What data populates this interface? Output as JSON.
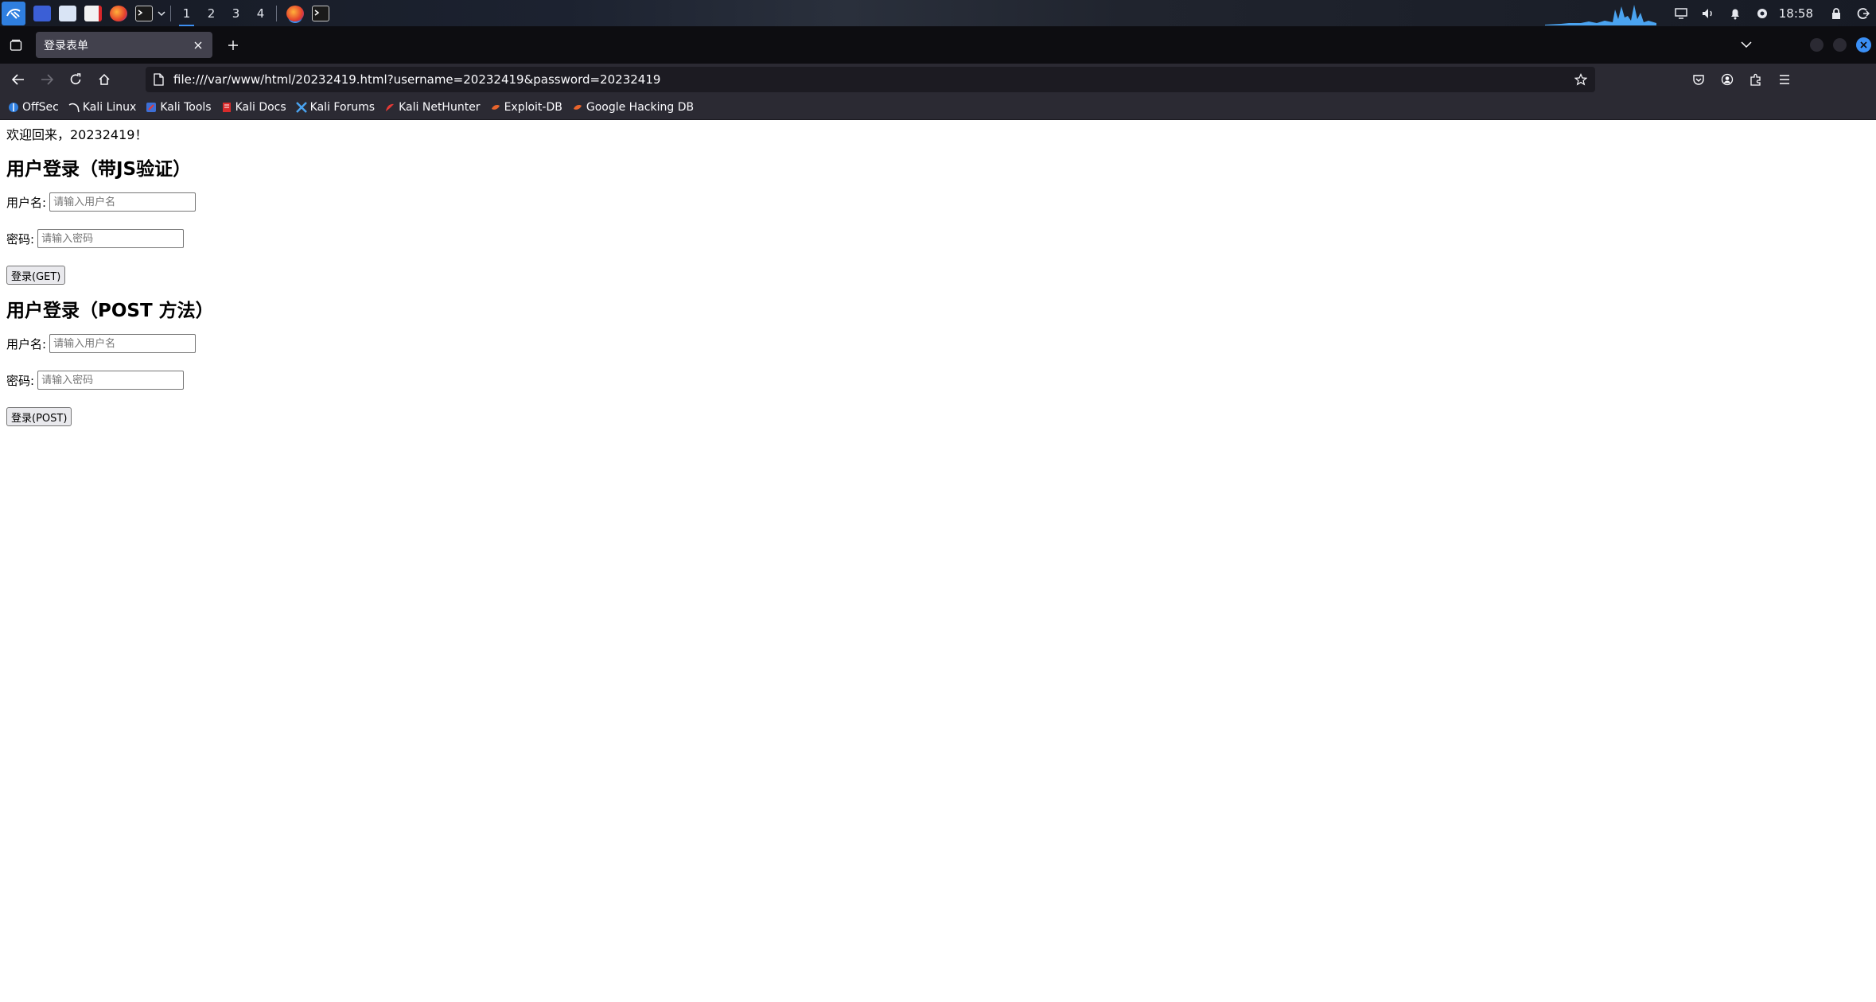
{
  "taskbar": {
    "workspaces": [
      "1",
      "2",
      "3",
      "4"
    ],
    "active_workspace": "1",
    "clock": "18:58",
    "accent_color": "#3d8ef0",
    "icons": [
      "kali-menu-icon",
      "desktop-icon",
      "files-icon",
      "text-editor-icon",
      "firefox-icon",
      "terminal-icon",
      "dropdown-icon"
    ]
  },
  "browser": {
    "tab_title": "登录表单",
    "url": "file:///var/www/html/20232419.html?username=20232419&password=20232419",
    "bookmarks": [
      {
        "label": "OffSec",
        "icon": "offsec-icon"
      },
      {
        "label": "Kali Linux",
        "icon": "kali-dragon-icon"
      },
      {
        "label": "Kali Tools",
        "icon": "kali-tools-icon"
      },
      {
        "label": "Kali Docs",
        "icon": "kali-docs-icon"
      },
      {
        "label": "Kali Forums",
        "icon": "kali-forums-icon"
      },
      {
        "label": "Kali NetHunter",
        "icon": "nethunter-icon"
      },
      {
        "label": "Exploit-DB",
        "icon": "exploitdb-icon"
      },
      {
        "label": "Google Hacking DB",
        "icon": "ghdb-icon"
      }
    ]
  },
  "page": {
    "welcome": "欢迎回来，20232419！",
    "form_get": {
      "title": "用户登录（带JS验证）",
      "username_label": "用户名:",
      "username_placeholder": "请输入用户名",
      "password_label": "密码:",
      "password_placeholder": "请输入密码",
      "submit_label": "登录(GET)"
    },
    "form_post": {
      "title": "用户登录（POST 方法）",
      "username_label": "用户名:",
      "username_placeholder": "请输入用户名",
      "password_label": "密码:",
      "password_placeholder": "请输入密码",
      "submit_label": "登录(POST)"
    }
  }
}
